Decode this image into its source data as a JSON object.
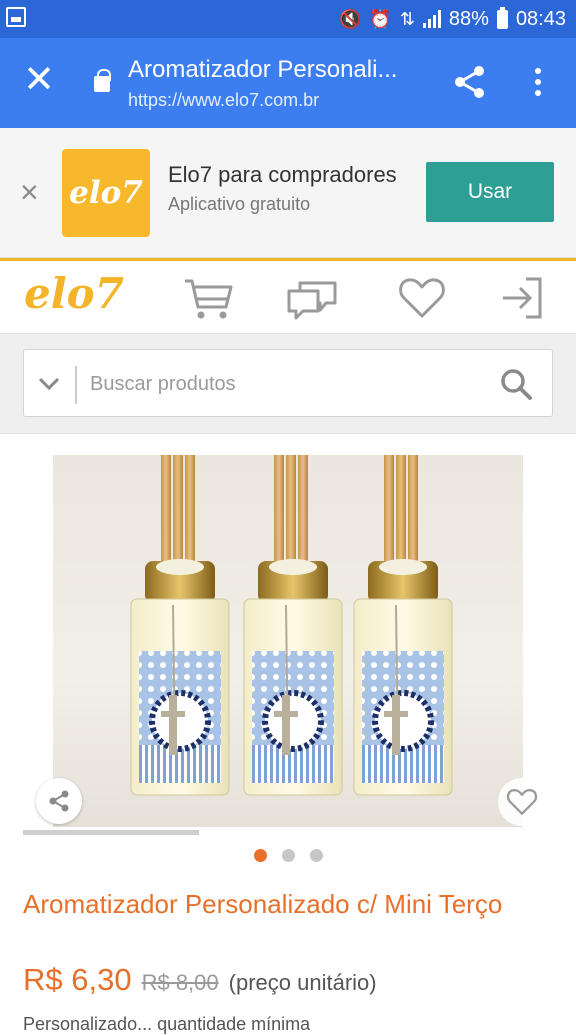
{
  "status_bar": {
    "battery_percent": "88%",
    "time": "08:43"
  },
  "tab": {
    "title": "Aromatizador Personali...",
    "url": "https://www.elo7.com.br"
  },
  "app_banner": {
    "logo_text": "elo7",
    "app_name": "Elo7 para compradores",
    "app_subtitle": "Aplicativo gratuito",
    "use_button": "Usar"
  },
  "header": {
    "brand": "elo7"
  },
  "search": {
    "placeholder": "Buscar produtos"
  },
  "product": {
    "title": "Aromatizador Personalizado c/ Mini Terço",
    "price": "R$ 6,30",
    "old_price": "R$ 8,00",
    "unit_note": "(preço unitário)",
    "cut_text": "Personalizado... quantidade mínima",
    "image_count": 3,
    "active_image": 1
  },
  "colors": {
    "status_bar": "#2b67d6",
    "tab_bar": "#3c7ef0",
    "brand_yellow": "#f3b42a",
    "accent_orange": "#e8702a",
    "use_button": "#2e9f94"
  }
}
